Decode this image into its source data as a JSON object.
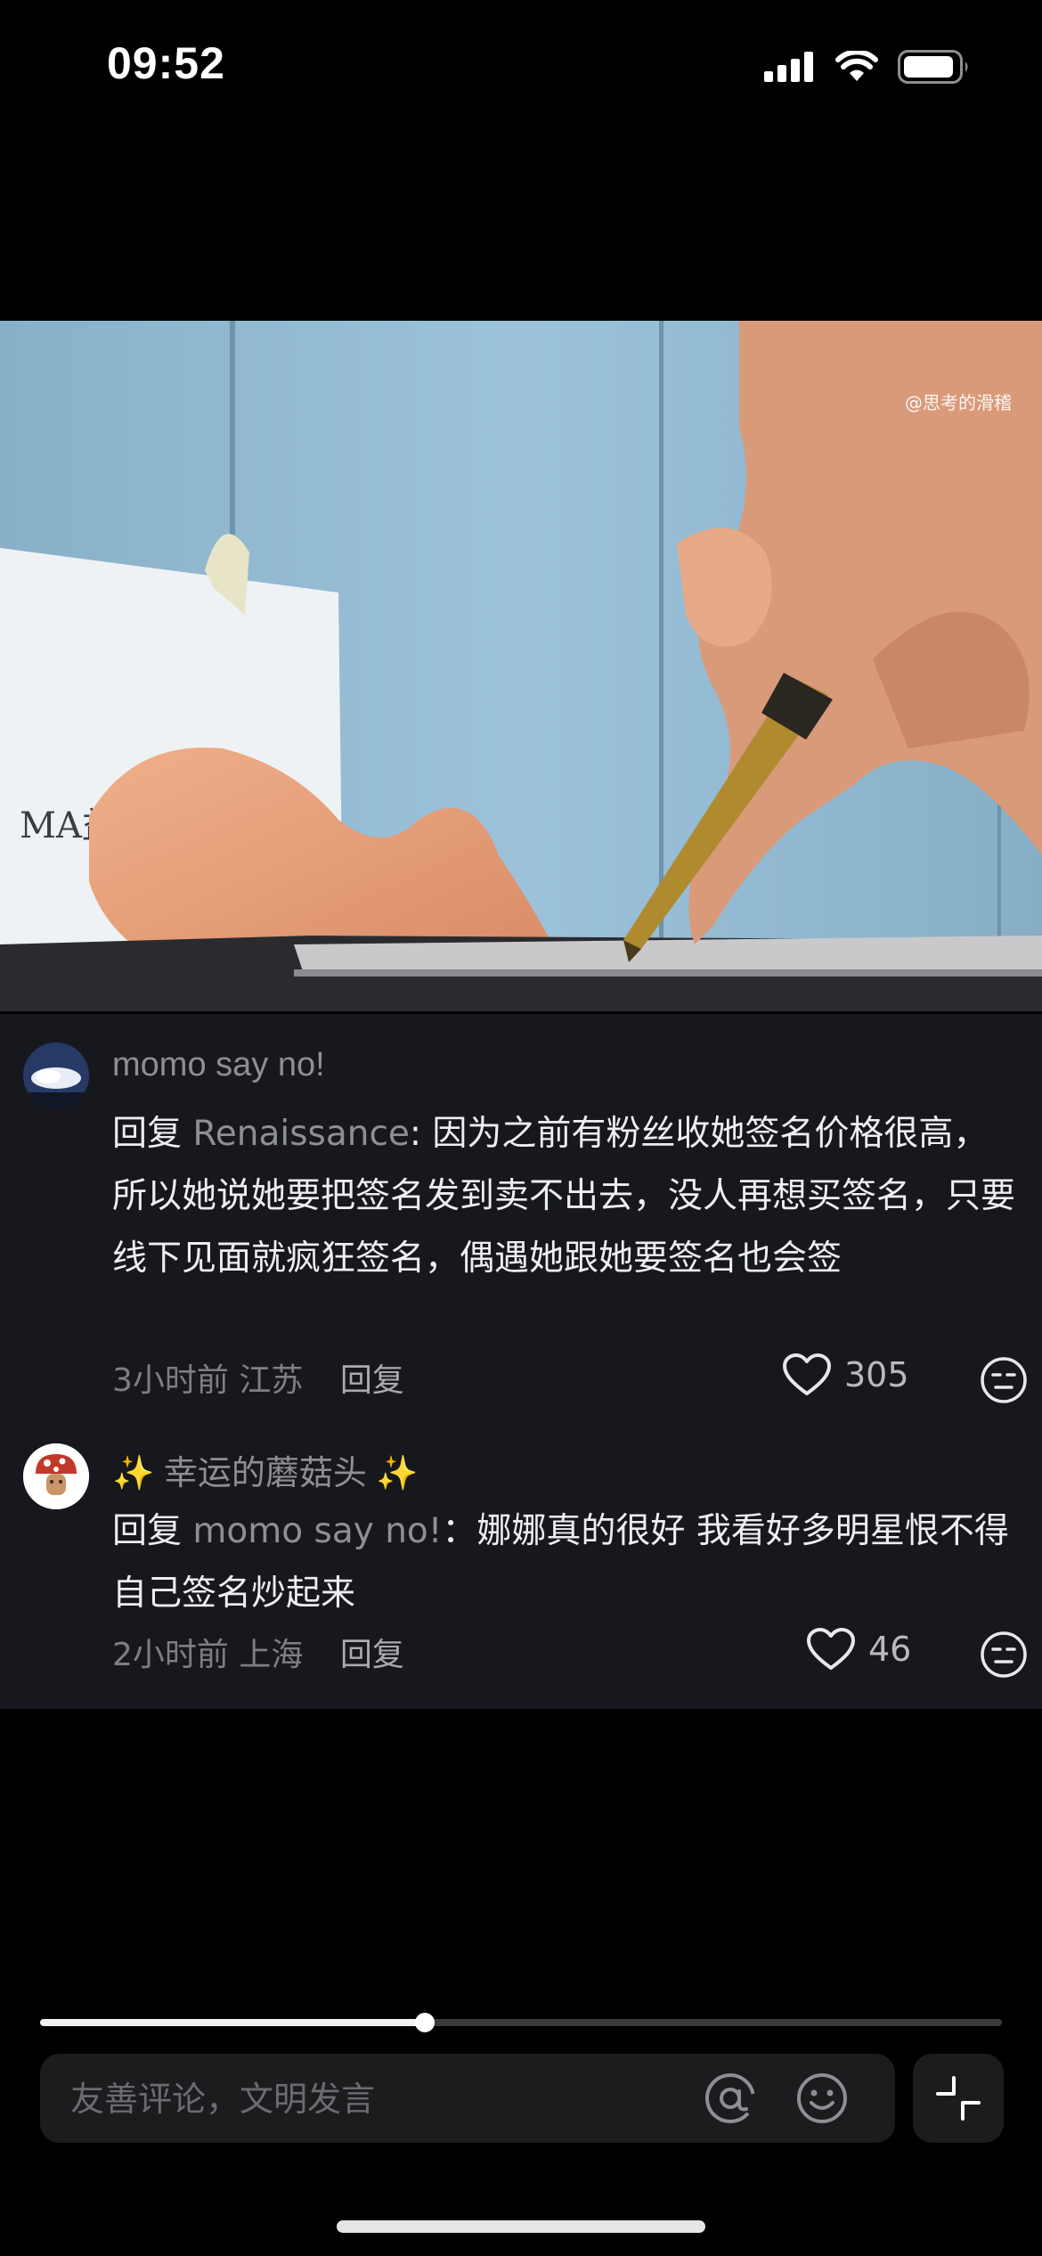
{
  "status_bar": {
    "time": "09:52"
  },
  "video": {
    "watermark": "@思考的滑稽"
  },
  "comments": [
    {
      "username": "momo say no!",
      "reply_prefix": "回复 ",
      "reply_to": "Renaissance",
      "text": ": 因为之前有粉丝收她签名价格很高，所以她说她要把签名发到卖不出去，没人再想买签名，只要线下见面就疯狂签名，偶遇她跟她要签名也会签",
      "time": "3小时前",
      "location": "江苏",
      "reply_label": "回复",
      "likes": "305"
    },
    {
      "username": "✨ 幸运的蘑菇头 ✨",
      "reply_prefix": "回复 ",
      "reply_to": "momo say no!",
      "text": "：娜娜真的很好 我看好多明星恨不得自己签名炒起来",
      "time": "2小时前",
      "location": "上海",
      "reply_label": "回复",
      "likes": "46"
    }
  ],
  "player": {
    "progress": 0.4
  },
  "input": {
    "placeholder": "友善评论，文明发言"
  },
  "icons": {
    "signal": "cellular-signal-icon",
    "wifi": "wifi-icon",
    "battery": "battery-icon",
    "heart": "heart-icon",
    "dislike": "dislike-face-icon",
    "at": "at-mention-icon",
    "emoji": "emoji-icon",
    "collapse": "collapse-icon"
  },
  "colors": {
    "background": "#000000",
    "comment_panel": "#16181d",
    "muted_text": "#8d8f95"
  }
}
